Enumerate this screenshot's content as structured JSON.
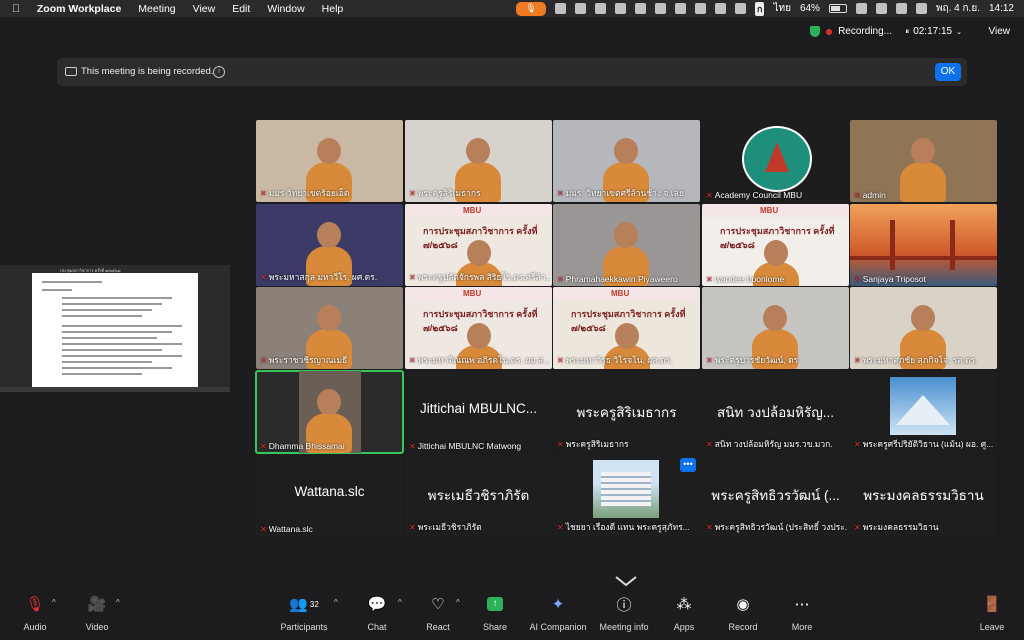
{
  "menubar": {
    "apple": "",
    "app": "Zoom Workplace",
    "items": [
      "Meeting",
      "View",
      "Edit",
      "Window",
      "Help"
    ],
    "mic_icon": "mic-icon",
    "input_lang": "ไทย",
    "battery": "64%",
    "date": "พฤ. 4 ก.ย.",
    "time": "14:12"
  },
  "topbar": {
    "recording": "Recording...",
    "timer": "02:17:15",
    "view": "View"
  },
  "banner": {
    "text": "This meeting is being recorded.",
    "ok": "OK"
  },
  "share_preview": {
    "title": "ประชุมสภาวิชาการ ครั้งที่ ๗/๒๕๖๘"
  },
  "tiles": [
    {
      "name": "มมร วิทยาเขตร้อยเอ็ด",
      "kind": "video",
      "bg": "#c9b9a4"
    },
    {
      "name": "พระครูสิริเมธากร",
      "kind": "video",
      "bg": "#d7d3cc"
    },
    {
      "name": "มมร. วิทยาเขตศรีล้านช้าง จ.เลย",
      "kind": "video",
      "bg": "#b5b7bd"
    },
    {
      "name": "Academy Council MBU",
      "kind": "logo",
      "bg": "#1d1d1d"
    },
    {
      "name": "admin",
      "kind": "video",
      "bg": "#8f7456"
    },
    {
      "name": "พระมหาสกุล มหาวีโร, ผศ.ดร.",
      "kind": "video",
      "bg": "#3c3a66"
    },
    {
      "name": "พระครูปลัดจักรพล สิริธโร,ดร.ศรีล้า...",
      "kind": "slide",
      "bg": "#efe8e1"
    },
    {
      "name": "Phramahaekkawin Piyaweero",
      "kind": "video",
      "bg": "#9a9695"
    },
    {
      "name": "wandee boonlome",
      "kind": "slide",
      "bg": "#f2eeea"
    },
    {
      "name": "Sanjaya Triposot",
      "kind": "bridge",
      "bg": "#d87a3a"
    },
    {
      "name": "พระราชวชิรญาณเมธี",
      "kind": "video",
      "bg": "#8b8178"
    },
    {
      "name": "พระมหาจิณณพ อภิรตโน,ดร. ผอ.ส...",
      "kind": "slide",
      "bg": "#efe7e1"
    },
    {
      "name": "พระมหาวิรุธ วิโรจโน, ผศ.ดร.",
      "kind": "slide",
      "bg": "#ede6dd"
    },
    {
      "name": "พระครูบวรชัยวัฒน์, ดร",
      "kind": "video",
      "bg": "#c6c5c2"
    },
    {
      "name": "พระมหาศุภชัย สุภกิจโจ, รศ.ดร.",
      "kind": "video",
      "bg": "#d9d2c6"
    },
    {
      "name": "Dhamma Bhissamai",
      "kind": "video",
      "bg": "#2b2b2b"
    },
    {
      "name": "Jittichai MBULNC Matwong",
      "kind": "text",
      "big": "Jittichai MBULNC...",
      "bg": "#1e1e1e"
    },
    {
      "name": "พระครูสิริเมธากร",
      "kind": "text",
      "big": "พระครูสิริเมธากร",
      "bg": "#1e1e1e"
    },
    {
      "name": "สนิท  วงปล้อมหิรัญ มมร.วข.มวก.",
      "kind": "text",
      "big": "สนิท วงปล้อมหิรัญ...",
      "bg": "#1e1e1e"
    },
    {
      "name": "พระครูศรีปริยัติวิธาน (แม้น) ผอ. ศู...",
      "kind": "photo",
      "bg": "#1e1e1e"
    },
    {
      "name": "Wattana.slc",
      "kind": "text",
      "big": "Wattana.slc",
      "bg": "#1e1e1e"
    },
    {
      "name": "พระเมธีวชิราภิรัต",
      "kind": "text",
      "big": "พระเมธีวชิราภิรัต",
      "bg": "#1e1e1e"
    },
    {
      "name": "ไชยยา  เรืองดี  แทน  พระครูสุภัทร...",
      "kind": "building",
      "bg": "#1e1e1e"
    },
    {
      "name": "พระครูสิทธิวรวัฒน์ (ประสิทธิ์ วงประ...",
      "kind": "text",
      "big": "พระครูสิทธิวรวัฒน์ (...",
      "bg": "#1e1e1e"
    },
    {
      "name": "พระมงคลธรรมวิธาน",
      "kind": "text",
      "big": "พระมงคลธรรมวิธาน",
      "bg": "#1e1e1e"
    }
  ],
  "slide_title": "การประชุมสภาวิชาการ ครั้งที่ ๗/๒๕๖๘",
  "slide_brand": "MBU",
  "gallery_more": "•••",
  "toolbar": {
    "audio": "Audio",
    "video": "Video",
    "participants": "Participants",
    "participants_count": "32",
    "chat": "Chat",
    "react": "React",
    "share": "Share",
    "ai": "AI Companion",
    "info": "Meeting info",
    "apps": "Apps",
    "record": "Record",
    "more": "More",
    "leave": "Leave"
  },
  "colors": {
    "accent": "#0e72ed",
    "share_green": "#2fb15a",
    "muted_red": "#e0302e",
    "active_speaker": "#35c759"
  }
}
